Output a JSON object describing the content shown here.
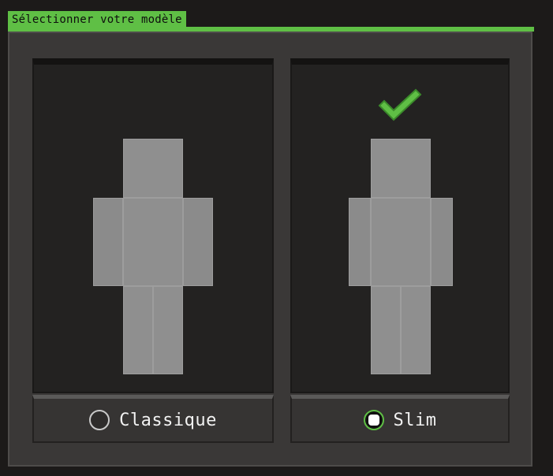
{
  "header": {
    "title": "Sélectionner votre modèle"
  },
  "colors": {
    "accent": "#5fbf45",
    "panel": "#3a3837",
    "preview_bg": "#232221",
    "figure": "#8f8f8f"
  },
  "options": [
    {
      "label": "Classique",
      "selected": false,
      "icon": "radio-icon"
    },
    {
      "label": "Slim",
      "selected": true,
      "icon": "checkmark-icon"
    }
  ]
}
